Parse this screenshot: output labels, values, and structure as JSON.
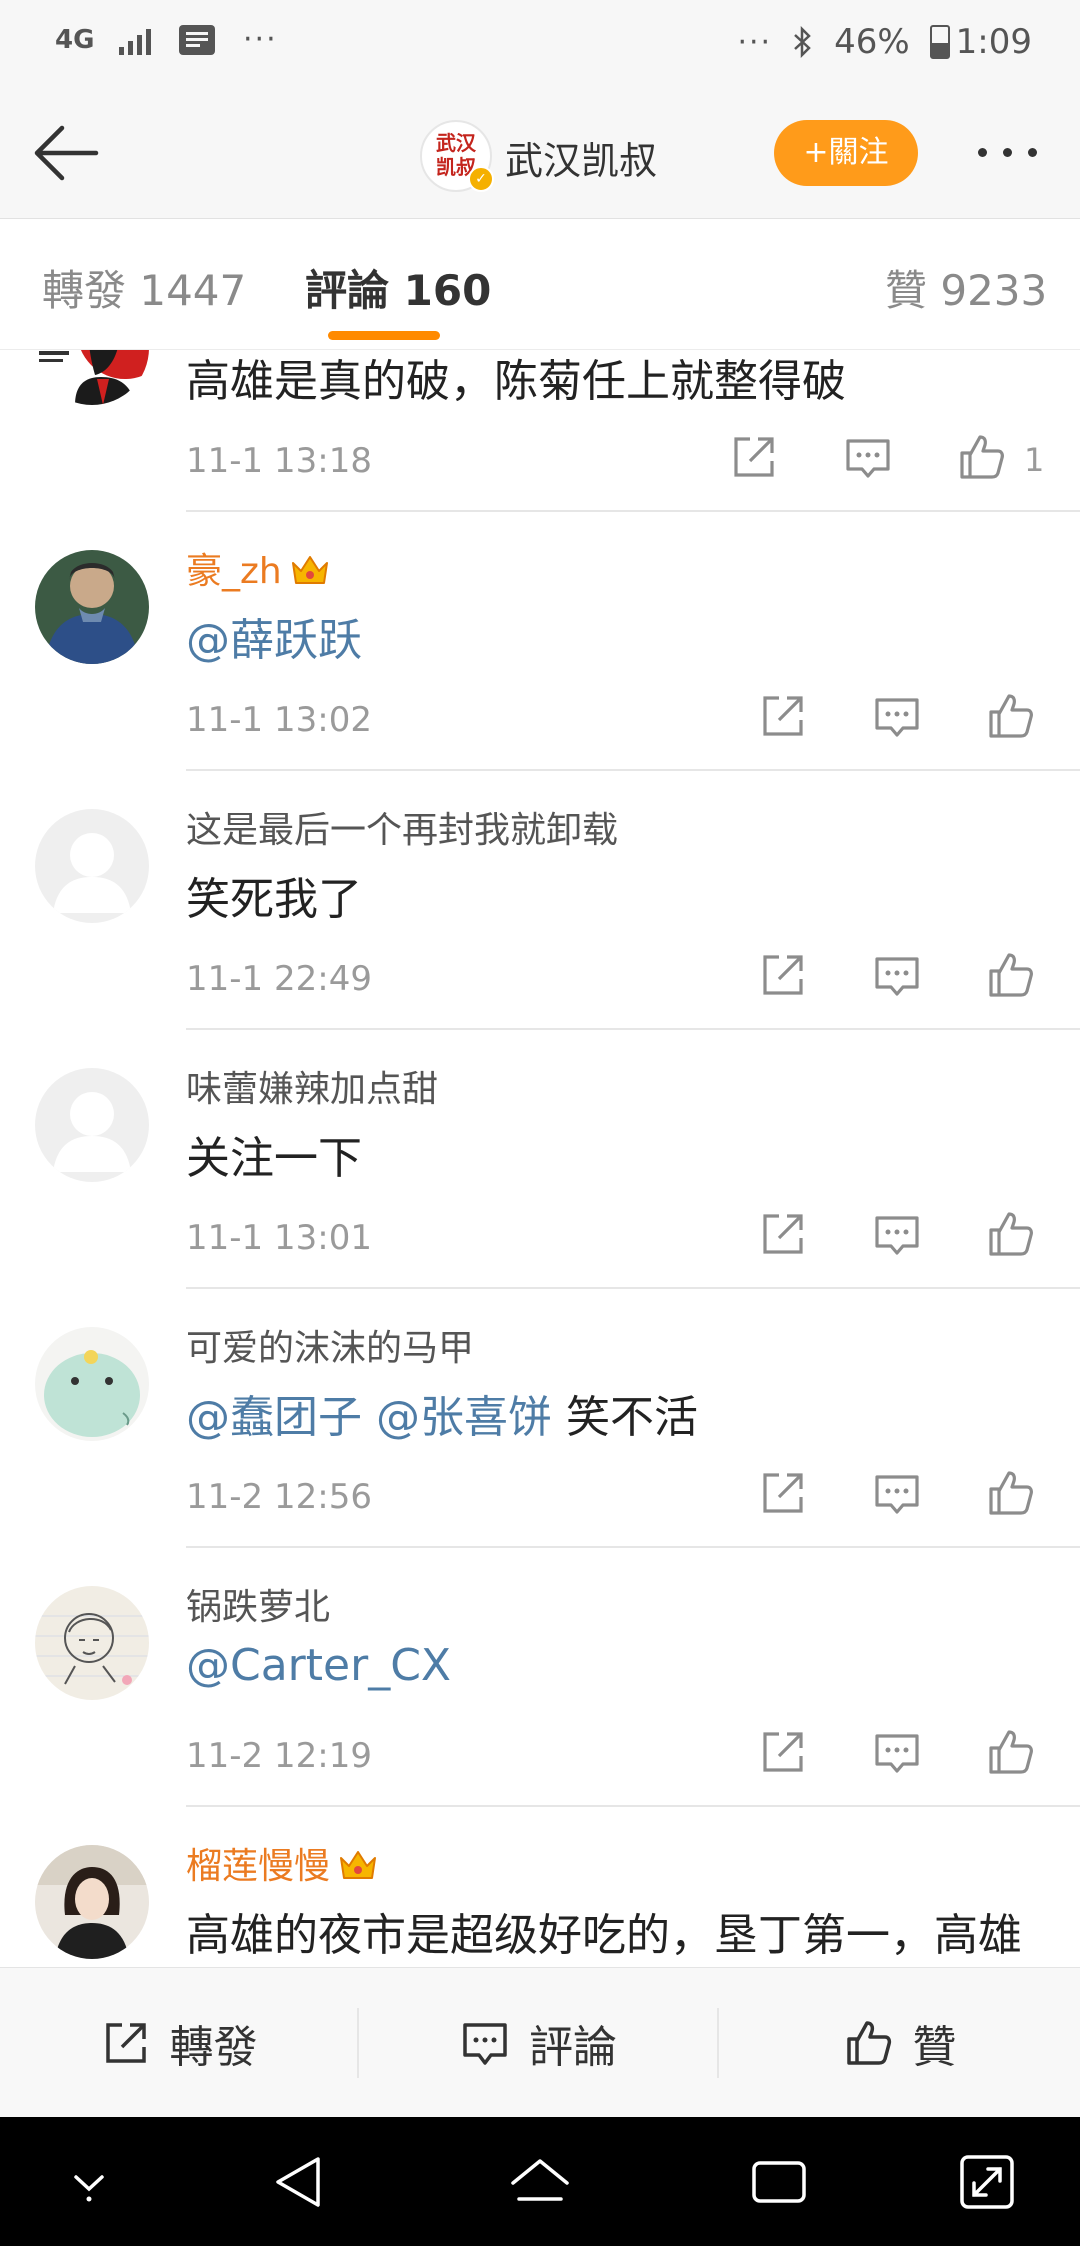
{
  "status_bar": {
    "network": "4G",
    "battery": "46%",
    "battery_level": 0.46,
    "time": "1:09"
  },
  "header": {
    "account_name": "武汉凯叔",
    "avatar_text": "武汉凯叔",
    "follow_label": "+關注"
  },
  "tabs": {
    "repost": "轉發 1447",
    "comment": "評論 160",
    "like": "贊 9233"
  },
  "comments": [
    {
      "user": "",
      "vip": false,
      "segments": [
        {
          "text": "高雄是真的破，陈菊任上就整得破",
          "mention": false
        }
      ],
      "time": "11-1 13:18",
      "likes": "1",
      "avatar": "man-utd"
    },
    {
      "user": "豪_zh",
      "vip": true,
      "segments": [
        {
          "text": "@薛跃跃",
          "mention": true
        }
      ],
      "time": "11-1 13:02",
      "likes": "",
      "avatar": "person-blue"
    },
    {
      "user": "这是最后一个再封我就卸载",
      "vip": false,
      "segments": [
        {
          "text": "笑死我了",
          "mention": false
        }
      ],
      "time": "11-1 22:49",
      "likes": "",
      "avatar": "default"
    },
    {
      "user": "味蕾嫌辣加点甜",
      "vip": false,
      "segments": [
        {
          "text": "关注一下",
          "mention": false
        }
      ],
      "time": "11-1 13:01",
      "likes": "",
      "avatar": "default"
    },
    {
      "user": "可爱的沫沫的马甲",
      "vip": false,
      "segments": [
        {
          "text": "@蠢团子",
          "mention": true
        },
        {
          "text": " ",
          "mention": false
        },
        {
          "text": "@张喜饼",
          "mention": true
        },
        {
          "text": " 笑不活",
          "mention": false
        }
      ],
      "time": "11-2 12:56",
      "likes": "",
      "avatar": "cartoon"
    },
    {
      "user": "锅跌萝北",
      "vip": false,
      "segments": [
        {
          "text": "@Carter_CX",
          "mention": true
        }
      ],
      "time": "11-2 12:19",
      "likes": "",
      "avatar": "sketch"
    },
    {
      "user": "榴莲慢慢",
      "vip": true,
      "segments": [
        {
          "text": "高雄的夜市是超级好吃的，垦丁第一，高雄",
          "mention": false
        }
      ],
      "time": "",
      "likes": "",
      "avatar": "girl"
    }
  ],
  "bottom_bar": {
    "repost": "轉發",
    "comment": "評論",
    "like": "贊"
  },
  "colors": {
    "accent_orange": "#ff8a00",
    "follow_button": "#ff9b1a",
    "vip_name": "#eb7b21",
    "mention_blue": "#4e7ca6"
  }
}
